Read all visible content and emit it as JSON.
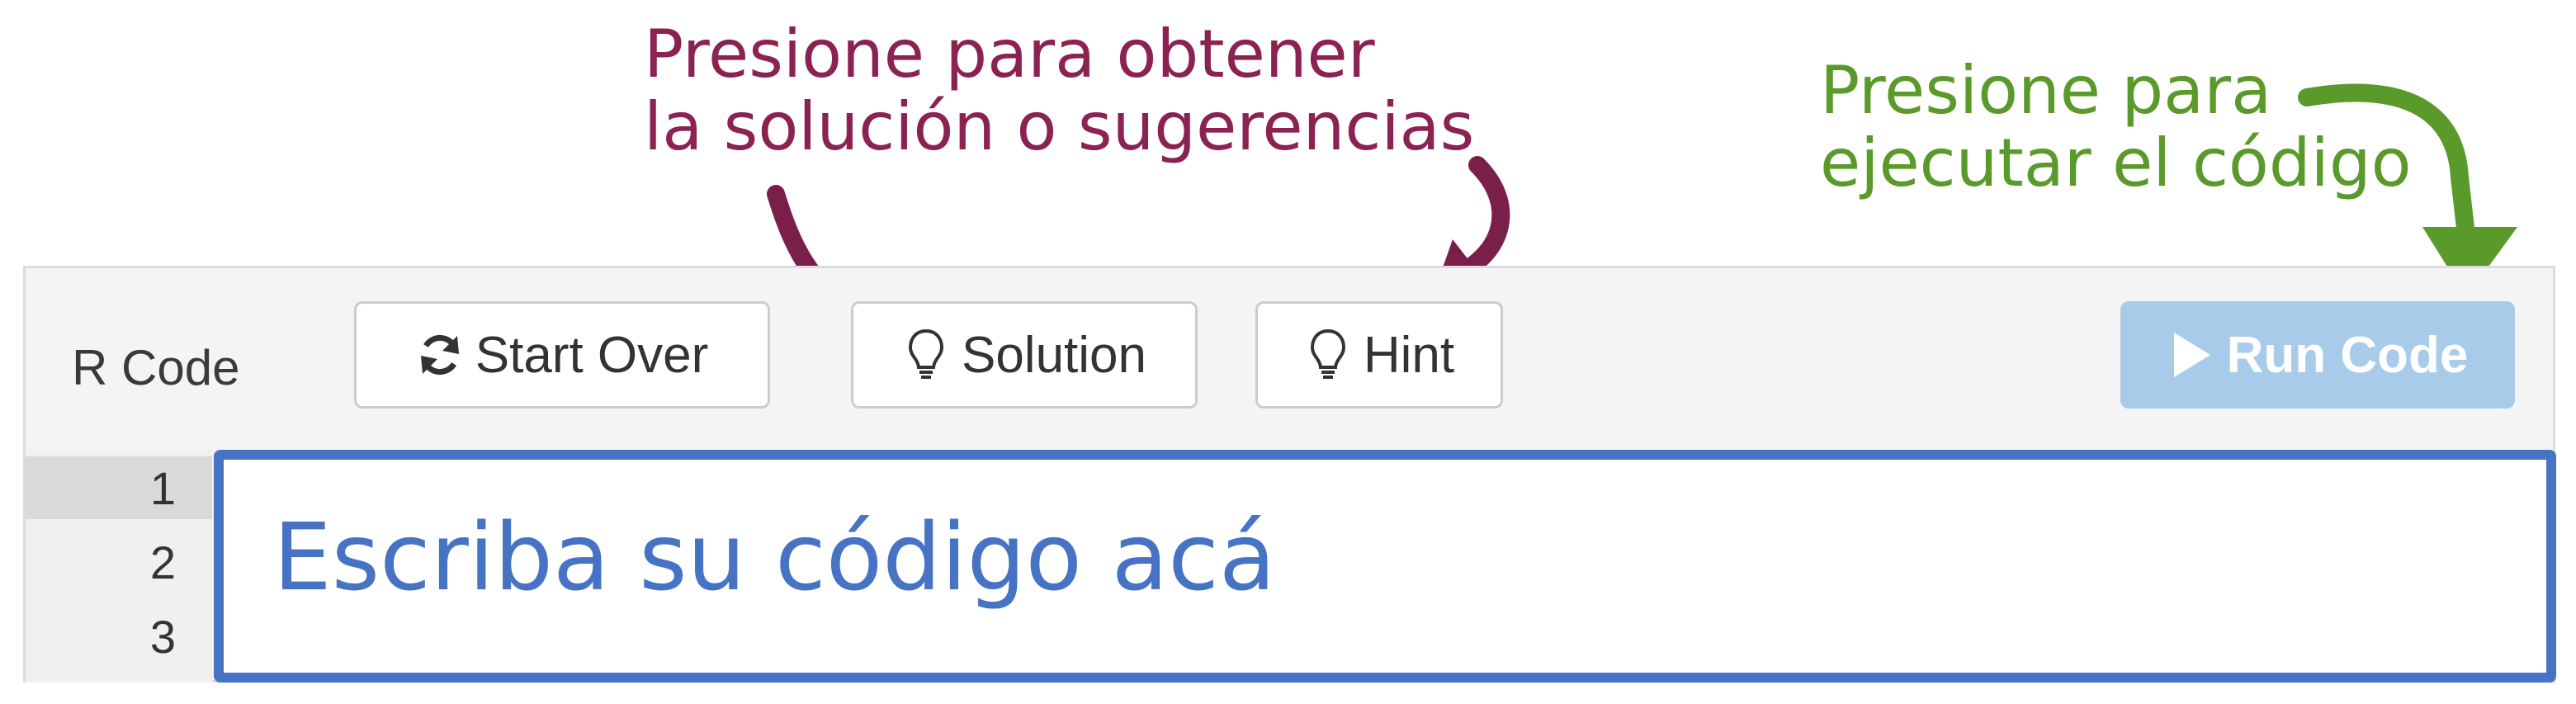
{
  "annotations": {
    "solution": {
      "line1": "Presione para obtener",
      "line2": "la solución o sugerencias",
      "color": "#8b2252"
    },
    "run": {
      "line1": "Presione para",
      "line2": "ejecutar el código",
      "color": "#5a9a2a"
    }
  },
  "toolbar": {
    "label": "R Code",
    "start_over_label": "Start Over",
    "solution_label": "Solution",
    "hint_label": "Hint",
    "run_label": "Run Code",
    "run_color": "#a9cbea"
  },
  "editor": {
    "line_numbers": [
      "1",
      "2",
      "3"
    ],
    "placeholder_text": "Escriba su código acá",
    "border_color": "#4673c4"
  },
  "icons": {
    "start_over": "refresh-icon",
    "solution": "lightbulb-icon",
    "hint": "lightbulb-icon",
    "run": "play-icon"
  }
}
